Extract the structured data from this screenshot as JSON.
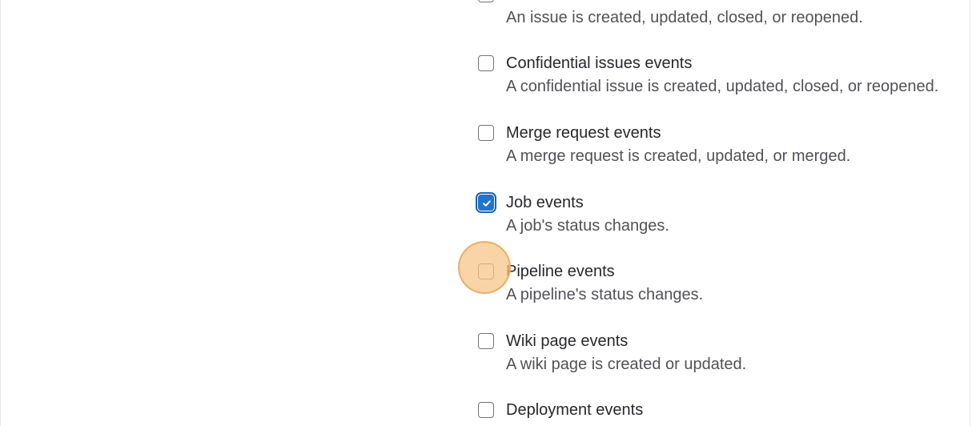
{
  "events": [
    {
      "id": "issues",
      "label": "",
      "description": "An issue is created, updated, closed, or reopened.",
      "checked": false
    },
    {
      "id": "confidential-issues",
      "label": "Confidential issues events",
      "description": "A confidential issue is created, updated, closed, or reopened.",
      "checked": false
    },
    {
      "id": "merge-request",
      "label": "Merge request events",
      "description": "A merge request is created, updated, or merged.",
      "checked": false
    },
    {
      "id": "job",
      "label": "Job events",
      "description": "A job's status changes.",
      "checked": true
    },
    {
      "id": "pipeline",
      "label": "Pipeline events",
      "description": "A pipeline's status changes.",
      "checked": false
    },
    {
      "id": "wiki-page",
      "label": "Wiki page events",
      "description": "A wiki page is created or updated.",
      "checked": false
    },
    {
      "id": "deployment",
      "label": "Deployment events",
      "description": "",
      "checked": false
    }
  ],
  "colors": {
    "checkbox_checked": "#1f75cb",
    "cursor_highlight": "#f6c484"
  }
}
